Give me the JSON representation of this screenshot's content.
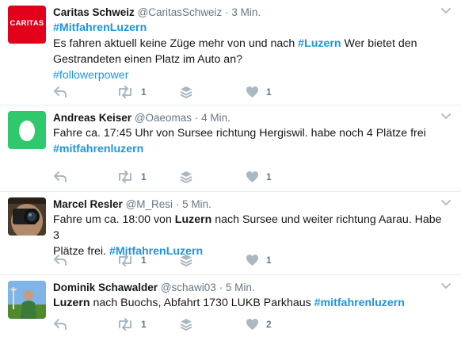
{
  "colors": {
    "link": "#1b95e0",
    "meta": "#657786",
    "icon": "#aab8c2",
    "divider": "#e6ecf0"
  },
  "tweets": [
    {
      "name": "Caritas Schweiz",
      "handle": "@CaritasSchweiz",
      "separator": "·",
      "time": "3 Min.",
      "avatar_label": "CARITAS",
      "text": {
        "hashtag1": "#MitfahrenLuzern",
        "line1": "Es fahren aktuell keine Züge mehr von und nach ",
        "bold1": "#Luzern",
        "line1b": " Wer bietet den",
        "line2": "Gestrandeten einen Platz im Auto an?",
        "hashtag2": "#followerpower"
      },
      "retweets": "1",
      "likes": "1"
    },
    {
      "name": "Andreas Keiser",
      "handle": "@Oaeomas",
      "separator": "·",
      "time": "4 Min.",
      "text": {
        "line1": "Fahre ca. 17:45 Uhr von Sursee richtung Hergiswil. habe noch 4 Plätze frei",
        "hashtag1": "#mitfahrenluzern"
      },
      "retweets": "1",
      "likes": "1"
    },
    {
      "name": "Marcel Resler",
      "handle": "@M_Resi",
      "separator": "·",
      "time": "5 Min.",
      "text": {
        "pre": "Fahre um ca. 18:00 von ",
        "bold1": "Luzern",
        "mid": " nach Sursee und  weiter richtung Aarau. Habe 3",
        "line2": "Plätze frei. ",
        "hashtag1": "#MitfahrenLuzern"
      },
      "retweets": "1",
      "likes": "1"
    },
    {
      "name": "Dominik Schawalder",
      "handle": "@schawi03",
      "separator": "·",
      "time": "5 Min.",
      "text": {
        "bold1": "Luzern",
        "mid": " nach Buochs, Abfahrt 1730 LUKB Parkhaus  ",
        "hashtag1": "#mitfahrenluzern"
      },
      "retweets": "1",
      "likes": "2"
    }
  ]
}
